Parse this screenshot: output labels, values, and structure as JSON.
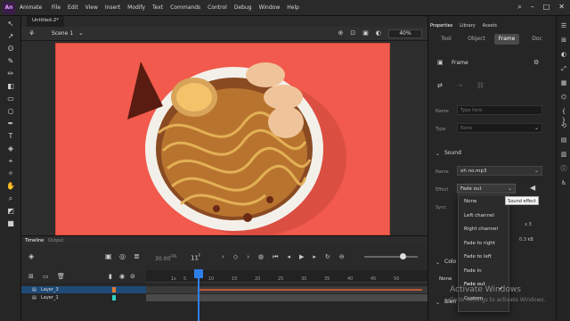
{
  "app": {
    "name": "Animate",
    "badge": "An"
  },
  "menu": [
    "File",
    "Edit",
    "View",
    "Insert",
    "Modify",
    "Text",
    "Commands",
    "Control",
    "Debug",
    "Window",
    "Help"
  ],
  "document": {
    "tab": "Untitled-2*",
    "scene": "Scene 1",
    "zoom": "40%"
  },
  "timeline": {
    "tabs": [
      "Timeline",
      "Output"
    ],
    "fps": "30.00",
    "fps_unit": "FPS",
    "frame": "11",
    "frame_unit": "F",
    "ticks": [
      "1s",
      "5",
      "10",
      "15",
      "20",
      "25",
      "30",
      "35",
      "40",
      "45",
      "50"
    ],
    "layers": [
      {
        "name": "Layer_3",
        "color": "#e07a2f",
        "selected": true
      },
      {
        "name": "Layer_1",
        "color": "#2fd0c8",
        "selected": false
      }
    ]
  },
  "properties": {
    "panel_tabs": [
      "Properties",
      "Library",
      "Assets"
    ],
    "sub_tabs": [
      "Tool",
      "Object",
      "Frame",
      "Doc"
    ],
    "active_sub_tab": "Frame",
    "section_frame": "Frame",
    "name_label": "Name",
    "name_placeholder": "Type here",
    "type_label": "Type",
    "type_value": "None",
    "sound_section": "Sound",
    "sound_name_label": "Name",
    "sound_name_value": "oh no.mp3",
    "effect_label": "Effect",
    "effect_value": "Fade out",
    "sync_label": "Sync",
    "sync_extra": "x 3",
    "size_info": "0.3 kB",
    "color_section": "Colo",
    "color_value": "None",
    "blend_section": "Blen"
  },
  "dropdown": {
    "options": [
      "None",
      "Left channel",
      "Right channel",
      "Fade to right",
      "Fade to left",
      "Fade in",
      "Fade out",
      "Custom"
    ],
    "selected": "Fade out",
    "tooltip": "Sound effect"
  },
  "os": {
    "watermark_title": "Activate Windows",
    "watermark_sub": "Go to Settings to activate Windows."
  },
  "colors": {
    "stage": "#f15a4c",
    "accent": "#2f7fe8"
  }
}
